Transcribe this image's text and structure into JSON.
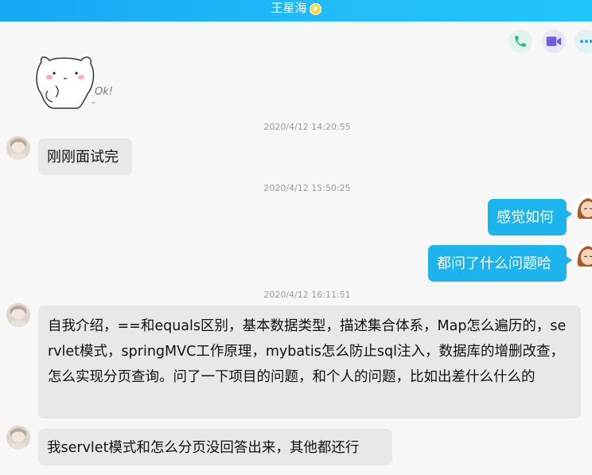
{
  "window": {
    "title": "王星海"
  },
  "sticker": {
    "text": "Ok!"
  },
  "messages": [
    {
      "time": "2020/4/12 14:20:55",
      "text": "刚刚面试完"
    },
    {
      "time": "2020/4/12 15:50:25",
      "text": "感觉如何"
    },
    {
      "text": "都问了什么问题哈"
    },
    {
      "time": "2020/4/12 16:11:51",
      "text": "自我介绍，==和equals区别，基本数据类型，描述集合体系，Map怎么遍历的，servlet模式，springMVC工作原理，mybatis怎么防止sql注入，数据库的增删改查，怎么实现分页查询。问了一下项目的问题，和个人的问题，比如出差什么什么的"
    },
    {
      "text": "我servlet模式和怎么分页没回答出来，其他都还行"
    }
  ],
  "icons": {
    "call": "phone-icon",
    "video": "video-camera-icon",
    "more": "more-icon",
    "vip": "star-icon"
  },
  "colors": {
    "titlebar": "#1fb6f7",
    "sent_bubble": "#1db3ec",
    "received_bubble": "#e8e8e8",
    "call_icon": "#21b98c",
    "video_icon": "#6b5fe0",
    "more_icon": "#2aa8e6"
  }
}
